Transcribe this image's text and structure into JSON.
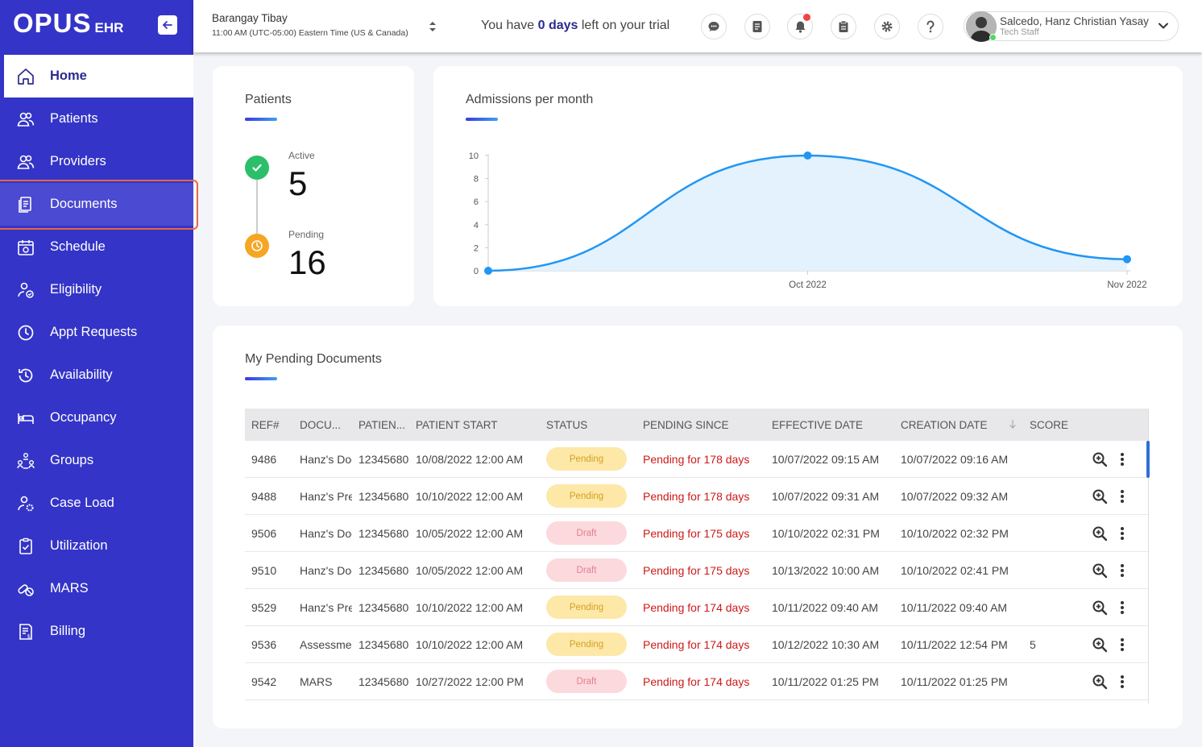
{
  "app": {
    "logo_main": "OPUS",
    "logo_sub": "EHR"
  },
  "sidebar": {
    "items": [
      {
        "label": "Home",
        "icon": "home-icon"
      },
      {
        "label": "Patients",
        "icon": "users-icon"
      },
      {
        "label": "Providers",
        "icon": "users-icon"
      },
      {
        "label": "Documents",
        "icon": "document-icon"
      },
      {
        "label": "Schedule",
        "icon": "calendar-icon"
      },
      {
        "label": "Eligibility",
        "icon": "user-check-icon"
      },
      {
        "label": "Appt Requests",
        "icon": "clock-icon"
      },
      {
        "label": "Availability",
        "icon": "history-icon"
      },
      {
        "label": "Occupancy",
        "icon": "bed-icon"
      },
      {
        "label": "Groups",
        "icon": "groups-icon"
      },
      {
        "label": "Case Load",
        "icon": "user-gear-icon"
      },
      {
        "label": "Utilization",
        "icon": "clipboard-check-icon"
      },
      {
        "label": "MARS",
        "icon": "pills-icon"
      },
      {
        "label": "Billing",
        "icon": "invoice-icon"
      }
    ]
  },
  "topbar": {
    "location_name": "Barangay Tibay",
    "timezone": "11:00 AM (UTC-05:00) Eastern Time (US & Canada)",
    "trial_prefix": "You have ",
    "trial_days": "0 days",
    "trial_suffix": " left on your trial",
    "user_name": "Salcedo, Hanz Christian Yasay",
    "user_role": "Tech Staff"
  },
  "patients_card": {
    "title": "Patients",
    "active_label": "Active",
    "active_value": "5",
    "pending_label": "Pending",
    "pending_value": "16"
  },
  "admissions_card": {
    "title": "Admissions per month"
  },
  "chart_data": {
    "type": "area",
    "title": "Admissions per month",
    "categories": [
      "",
      "Oct 2022",
      "Nov 2022"
    ],
    "values": [
      0,
      10,
      1
    ],
    "ylim": [
      0,
      10
    ],
    "yticks": [
      "0",
      "2",
      "4",
      "6",
      "8",
      "10"
    ],
    "grid": false,
    "color": "#2196f3",
    "fill": "#e3f2fd"
  },
  "pending_docs": {
    "title": "My Pending Documents",
    "columns": [
      "REF#",
      "DOCU...",
      "PATIEN...",
      "PATIENT START",
      "STATUS",
      "PENDING SINCE",
      "EFFECTIVE DATE",
      "CREATION DATE",
      "SCORE"
    ],
    "rows": [
      {
        "ref": "9486",
        "doc": "Hanz's Doc",
        "patient": "12345680",
        "start": "10/08/2022 12:00 AM",
        "status": "Pending",
        "pending": "Pending for 178 days",
        "effective": "10/07/2022 09:15 AM",
        "created": "10/07/2022 09:16 AM",
        "score": ""
      },
      {
        "ref": "9488",
        "doc": "Hanz's Pre",
        "patient": "12345680",
        "start": "10/10/2022 12:00 AM",
        "status": "Pending",
        "pending": "Pending for 178 days",
        "effective": "10/07/2022 09:31 AM",
        "created": "10/07/2022 09:32 AM",
        "score": ""
      },
      {
        "ref": "9506",
        "doc": "Hanz's Doc",
        "patient": "12345680",
        "start": "10/05/2022 12:00 AM",
        "status": "Draft",
        "pending": "Pending for 175 days",
        "effective": "10/10/2022 02:31 PM",
        "created": "10/10/2022 02:32 PM",
        "score": ""
      },
      {
        "ref": "9510",
        "doc": "Hanz's Doc",
        "patient": "12345680",
        "start": "10/05/2022 12:00 AM",
        "status": "Draft",
        "pending": "Pending for 175 days",
        "effective": "10/13/2022 10:00 AM",
        "created": "10/10/2022 02:41 PM",
        "score": ""
      },
      {
        "ref": "9529",
        "doc": "Hanz's Pre",
        "patient": "12345680",
        "start": "10/10/2022 12:00 AM",
        "status": "Pending",
        "pending": "Pending for 174 days",
        "effective": "10/11/2022 09:40 AM",
        "created": "10/11/2022 09:40 AM",
        "score": ""
      },
      {
        "ref": "9536",
        "doc": "Assessme",
        "patient": "12345680",
        "start": "10/10/2022 12:00 AM",
        "status": "Pending",
        "pending": "Pending for 174 days",
        "effective": "10/12/2022 10:30 AM",
        "created": "10/11/2022 12:54 PM",
        "score": "5"
      },
      {
        "ref": "9542",
        "doc": "MARS",
        "patient": "12345680",
        "start": "10/27/2022 12:00 PM",
        "status": "Draft",
        "pending": "Pending for 174 days",
        "effective": "10/11/2022 01:25 PM",
        "created": "10/11/2022 01:25 PM",
        "score": ""
      }
    ]
  }
}
